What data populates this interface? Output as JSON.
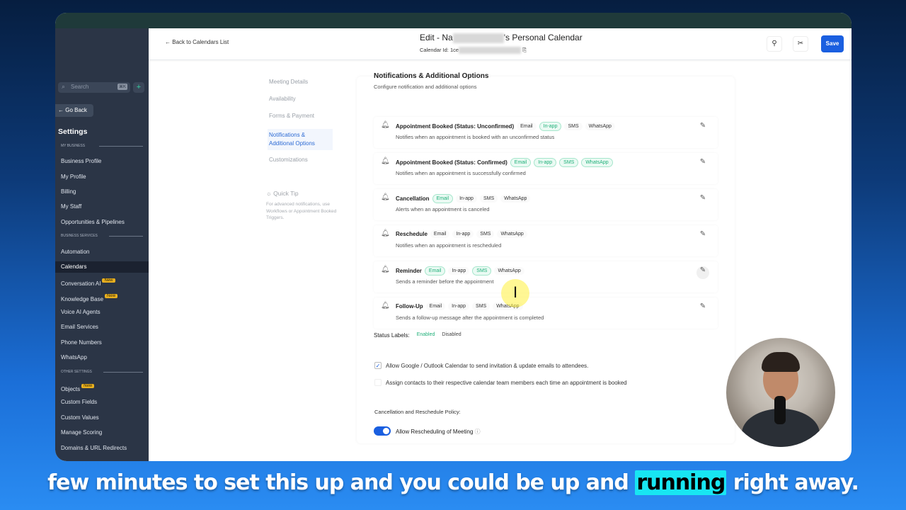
{
  "sidebar": {
    "search_placeholder": "Search",
    "shortcut": "⌘K",
    "go_back": "Go Back",
    "settings_title": "Settings",
    "sections": [
      "MY BUSINESS",
      "BUSINESS SERVICES",
      "OTHER SETTINGS"
    ],
    "items": [
      "Business Profile",
      "My Profile",
      "Billing",
      "My Staff",
      "Opportunities & Pipelines",
      "Automation",
      "Calendars",
      "Conversation AI",
      "Knowledge Base",
      "Voice AI Agents",
      "Email Services",
      "Phone Numbers",
      "WhatsApp",
      "Objects",
      "Custom Fields",
      "Custom Values",
      "Manage Scoring",
      "Domains & URL Redirects"
    ],
    "new_badge": "New"
  },
  "header": {
    "back": "Back to Calendars List",
    "title_prefix": "Edit - Na",
    "title_suffix": "'s Personal Calendar",
    "calendar_id_label": "Calendar Id: 1ce",
    "save": "Save"
  },
  "left_nav": {
    "items": [
      "Meeting Details",
      "Availability",
      "Forms & Payment",
      "Notifications & Additional Options",
      "Customizations"
    ],
    "quick_tip_title": "Quick Tip",
    "quick_tip_text": "For advanced notifications, use Workflows or Appointment Booked Triggers."
  },
  "section": {
    "title": "Notifications & Additional Options",
    "subtitle": "Configure notification and additional options"
  },
  "notifications": [
    {
      "title": "Appointment Booked (Status: Unconfirmed)",
      "desc": "Notifies when an appointment is booked with an unconfirmed status",
      "channels": [
        {
          "n": "Email",
          "on": false
        },
        {
          "n": "In-app",
          "on": true
        },
        {
          "n": "SMS",
          "on": false
        },
        {
          "n": "WhatsApp",
          "on": false
        }
      ]
    },
    {
      "title": "Appointment Booked (Status: Confirmed)",
      "desc": "Notifies when an appointment is successfully confirmed",
      "channels": [
        {
          "n": "Email",
          "on": true
        },
        {
          "n": "In-app",
          "on": true
        },
        {
          "n": "SMS",
          "on": true
        },
        {
          "n": "WhatsApp",
          "on": true
        }
      ]
    },
    {
      "title": "Cancellation",
      "desc": "Alerts when an appointment is canceled",
      "channels": [
        {
          "n": "Email",
          "on": true
        },
        {
          "n": "In-app",
          "on": false
        },
        {
          "n": "SMS",
          "on": false
        },
        {
          "n": "WhatsApp",
          "on": false
        }
      ]
    },
    {
      "title": "Reschedule",
      "desc": "Notifies when an appointment is rescheduled",
      "channels": [
        {
          "n": "Email",
          "on": false
        },
        {
          "n": "In-app",
          "on": false
        },
        {
          "n": "SMS",
          "on": false
        },
        {
          "n": "WhatsApp",
          "on": false
        }
      ]
    },
    {
      "title": "Reminder",
      "desc": "Sends a reminder before the appointment",
      "channels": [
        {
          "n": "Email",
          "on": true
        },
        {
          "n": "In-app",
          "on": false
        },
        {
          "n": "SMS",
          "on": true
        },
        {
          "n": "WhatsApp",
          "on": false
        }
      ]
    },
    {
      "title": "Follow-Up",
      "desc": "Sends a follow-up message after the appointment is completed",
      "channels": [
        {
          "n": "Email",
          "on": false
        },
        {
          "n": "In-app",
          "on": false
        },
        {
          "n": "SMS",
          "on": false
        },
        {
          "n": "WhatsApp",
          "on": false
        }
      ]
    }
  ],
  "status_labels": {
    "label": "Status Labels:",
    "enabled": "Enabled",
    "disabled": "Disabled"
  },
  "options": [
    {
      "label": "Allow Google / Outlook Calendar to send invitation & update emails to attendees.",
      "checked": true
    },
    {
      "label": "Assign contacts to their respective calendar team members each time an appointment is booked",
      "checked": false
    }
  ],
  "policy": {
    "title": "Cancellation and Reschedule Policy:",
    "toggle_label": "Allow Rescheduling of Meeting",
    "toggle_on": true
  },
  "caption": {
    "before": "few minutes to set this up and you could be up and ",
    "highlight": "running",
    "after": " right away."
  }
}
